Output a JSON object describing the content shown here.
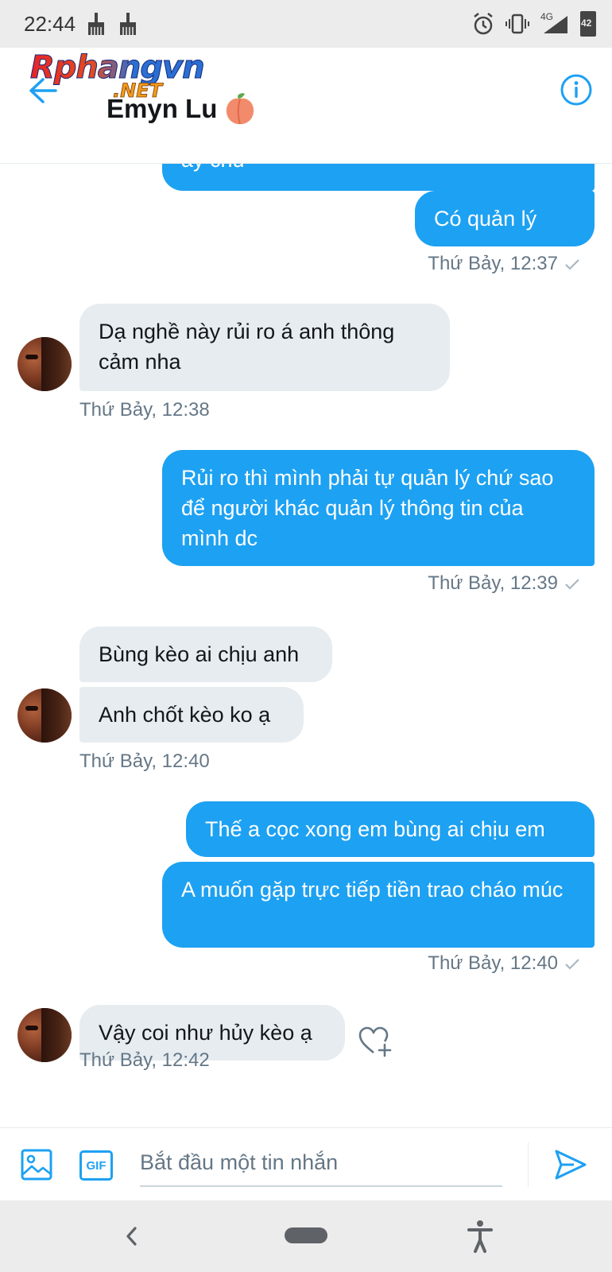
{
  "status_bar": {
    "time": "22:44",
    "network": "4G",
    "battery": "42",
    "icons": [
      "broom-icon",
      "broom-icon",
      "alarm-icon",
      "vibrate-icon",
      "signal-icon",
      "battery-icon"
    ]
  },
  "header": {
    "watermark": "Rphangvn",
    "watermark_suffix": ".NET",
    "contact_name": "Emyn Lu",
    "contact_emoji": "peach-icon",
    "accent_color": "#1da1f2"
  },
  "conversation": {
    "partial_top": "ấy chứ",
    "messages": [
      {
        "side": "out",
        "text": "Có quản lý"
      },
      {
        "side": "in",
        "text": "Dạ nghề này rủi ro á anh thông cảm nha"
      },
      {
        "side": "out",
        "text": "Rủi ro thì mình phải tự quản lý chứ sao để người khác quản lý thông tin của mình dc"
      },
      {
        "side": "in",
        "text": "Bùng kèo ai chịu anh"
      },
      {
        "side": "in",
        "text": "Anh chốt kèo ko ạ"
      },
      {
        "side": "out",
        "text": "Thế a cọc xong em bùng ai chịu em"
      },
      {
        "side": "out",
        "text": "A muốn gặp trực tiếp tiền trao cháo múc"
      },
      {
        "side": "in",
        "text": "Vậy coi như hủy kèo ạ"
      }
    ],
    "timestamps": [
      "Thứ Bảy, 12:37",
      "Thứ Bảy, 12:38",
      "Thứ Bảy, 12:39",
      "Thứ Bảy, 12:40",
      "Thứ Bảy, 12:40",
      "Thứ Bảy, 12:42"
    ]
  },
  "composer": {
    "placeholder": "Bắt đầu một tin nhắn",
    "gif_label": "GIF"
  },
  "colors": {
    "outgoing_bubble": "#1da1f2",
    "incoming_bubble": "#e6ecf0",
    "timestamp": "#657786"
  }
}
